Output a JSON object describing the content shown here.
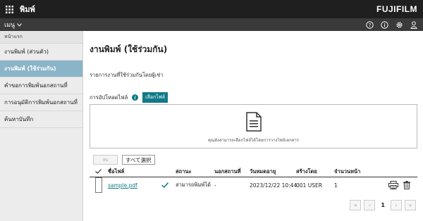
{
  "app": {
    "title": "พิมพ์",
    "brand": "FUJIFILM"
  },
  "subbar": {
    "menu_label": "เมนู"
  },
  "sidebar": {
    "header": "หน้าแรก",
    "items": [
      {
        "label": "งานพิมพ์ (ส่วนตัว)"
      },
      {
        "label": "งานพิมพ์ (ใช้ร่วมกัน)"
      },
      {
        "label": "คำขอการพิมพ์นอกสถานที่"
      },
      {
        "label": "การอนุมัติการพิมพ์นอกสถานที่"
      },
      {
        "label": "ค้นหาบันทึก"
      }
    ]
  },
  "main": {
    "title": "งานพิมพ์ (ใช้ร่วมกัน)",
    "description": "รายการงานที่ใช้ร่วมกันโดยผู้เช่า",
    "upload_label": "การอัปโหลดไฟล์",
    "choose_file": "เลือกไฟล์",
    "drop_text": "คุณยังสามารถเลือกไฟล์ได้โดยการวางไฟล์เอกสาร",
    "delete_btn": "ลบ",
    "select_all_btn": "すべて選択"
  },
  "table": {
    "headers": {
      "filename": "ชื่อไฟล์",
      "status": "สถานะ",
      "offsite": "นอกสถานที่",
      "expiry": "วันหมดอายุ",
      "creator": "สร้างโดย",
      "pages": "จำนวนหน้า"
    },
    "rows": [
      {
        "filename": "sample.pdf",
        "status": "สามารถพิมพ์ได้",
        "offsite": "-",
        "expiry": "2023/12/22 10:44",
        "creator": "001 USER",
        "pages": "1"
      }
    ]
  },
  "pager": {
    "current": "1"
  },
  "colors": {
    "accent": "#0f7a88",
    "sidebar_active": "#8ab4c7",
    "topbar": "#1f1f1f"
  }
}
